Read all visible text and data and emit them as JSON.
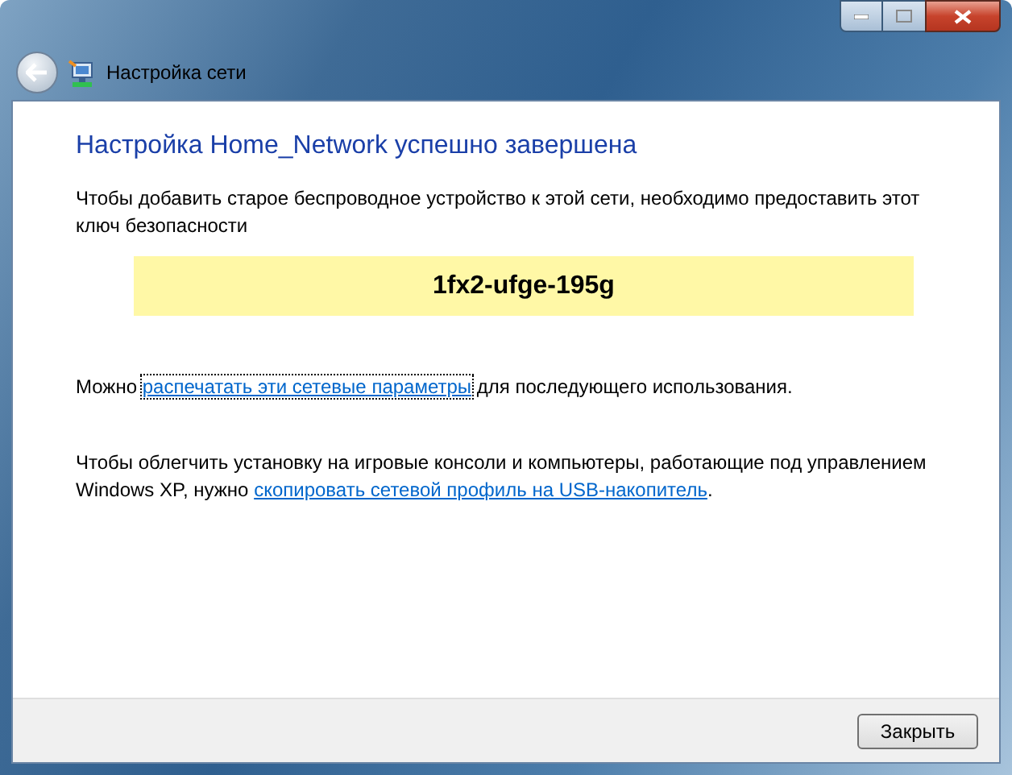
{
  "window": {
    "title": "Настройка сети"
  },
  "heading": "Настройка Home_Network успешно завершена",
  "intro": "Чтобы добавить старое беспроводное устройство к этой сети, необходимо предоставить этот ключ безопасности",
  "security_key": "1fx2-ufge-195g",
  "print_line": {
    "before": "Можно",
    "link": "распечатать эти сетевые параметры",
    "after": "для последующего использования.",
    "focused": true
  },
  "usb_line": {
    "before": "Чтобы облегчить установку на игровые консоли и компьютеры, работающие под управлением Windows XP, нужно",
    "link": "скопировать сетевой профиль на USB-накопитель",
    "after": "."
  },
  "buttons": [
    {
      "label": "Закрыть"
    }
  ]
}
